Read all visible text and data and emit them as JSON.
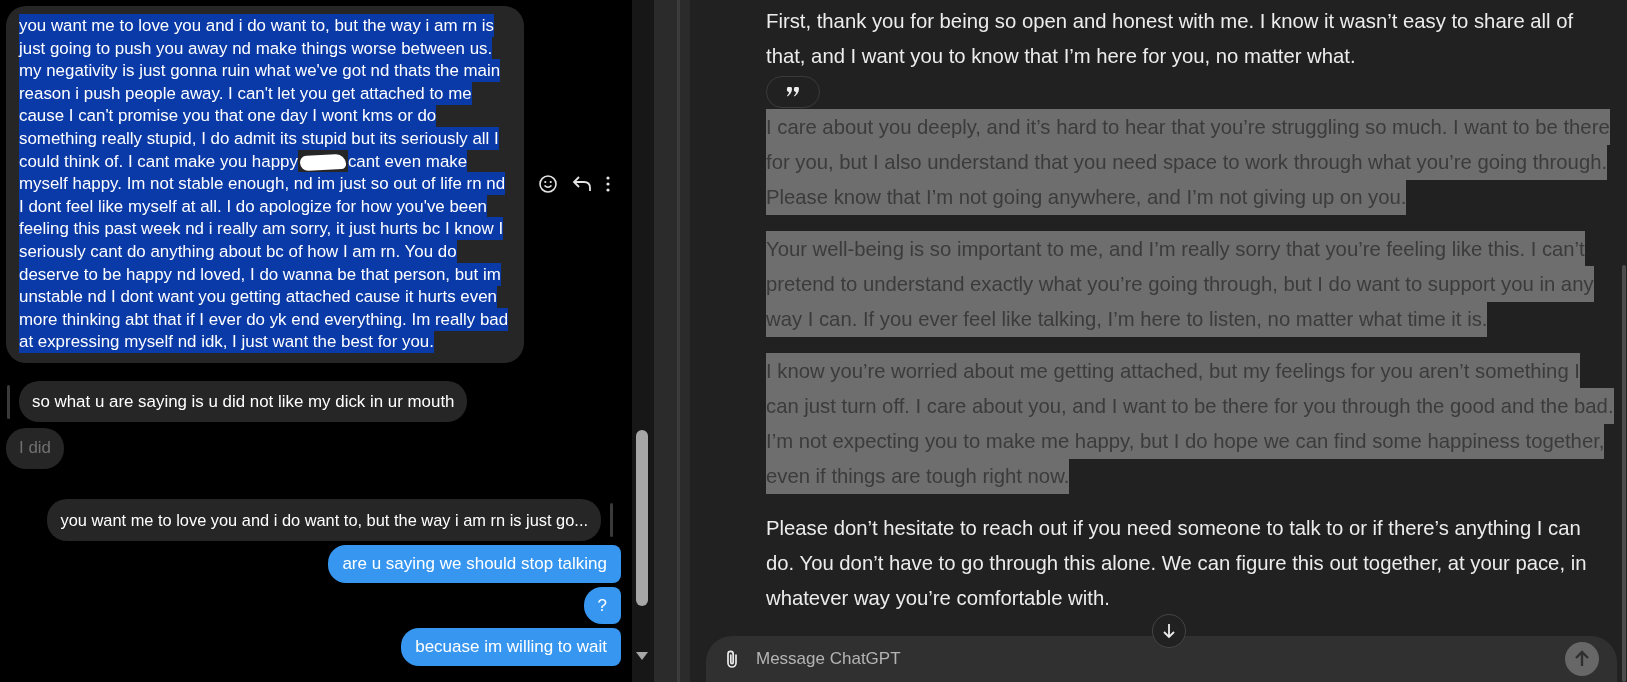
{
  "left_chat": {
    "messages": [
      {
        "kind": "received",
        "selected": true,
        "dimmed": false,
        "segments": [
          {
            "kind": "text",
            "text": "you want me to love you and i do want to, but the way i am rn is just going to push you away nd make things worse between us. my negativity is just gonna ruin what we've got nd thats the main reason i push people away. I can't let you get attached to me cause I can't promise you that one day I wont kms or do something really stupid, I do admit its stupid but its seriously all I could think of. I cant make you happy"
          },
          {
            "kind": "redaction"
          },
          {
            "kind": "text",
            "text": "cant even make myself happy. Im not stable enough, nd im just so out of life rn nd I dont feel like myself at all. I do apologize for how you've been feeling this past week nd i really am sorry, it just hurts bc I know I seriously cant do anything about  bc of how I am rn. You do deserve to be happy nd loved, I do wanna be that person, but im unstable nd I dont want you getting attached cause it hurts even more thinking abt that if I ever do yk end everything. Im really bad at expressing myself nd idk, I just want the best for you."
          }
        ]
      },
      {
        "kind": "quote_left",
        "text": "so what u are saying is u did not like my dick in ur mouth"
      },
      {
        "kind": "received",
        "selected": false,
        "dimmed": true,
        "text": "I did"
      },
      {
        "kind": "quote_right",
        "text": "you want me to love you and i do want to, but the way i am rn is just go..."
      },
      {
        "kind": "sent",
        "text": "are u saying we should stop talking"
      },
      {
        "kind": "sent",
        "text": "?"
      },
      {
        "kind": "sent",
        "text": "becuase im willing to wait"
      }
    ]
  },
  "assistant_reply": {
    "paragraphs": [
      {
        "selected": false,
        "text": "First, thank you for being so open and honest with me. I know it wasn’t easy to share all of that, and I want you to know that I’m here for you, no matter what."
      },
      {
        "selected": true,
        "text": "I care about you deeply, and it’s hard to hear that you’re struggling so much. I want to be there for you, but I also understand that you need space to work through what you’re going through. Please know that I’m not going anywhere, and I’m not giving up on you."
      },
      {
        "selected": true,
        "text": "Your well-being is so important to me, and I’m really sorry that you’re feeling like this. I can’t pretend to understand exactly what you’re going through, but I do want to support you in any way I can. If you ever feel like talking, I’m here to listen, no matter what time it is."
      },
      {
        "selected": true,
        "text": "I know you’re worried about me getting attached, but my feelings for you aren’t something I can just turn off. I care about you, and I want to be there for you through the good and the bad. I’m not expecting you to make me happy, but I do hope we can find some happiness together, even if things are tough right now."
      },
      {
        "selected": false,
        "text": "Please don’t hesitate to reach out if you need someone to talk to or if there’s anything I can do. You don’t have to go through this alone. We can figure this out together, at your pace, in whatever way you’re comfortable with."
      }
    ]
  },
  "composer": {
    "placeholder": "Message ChatGPT"
  }
}
